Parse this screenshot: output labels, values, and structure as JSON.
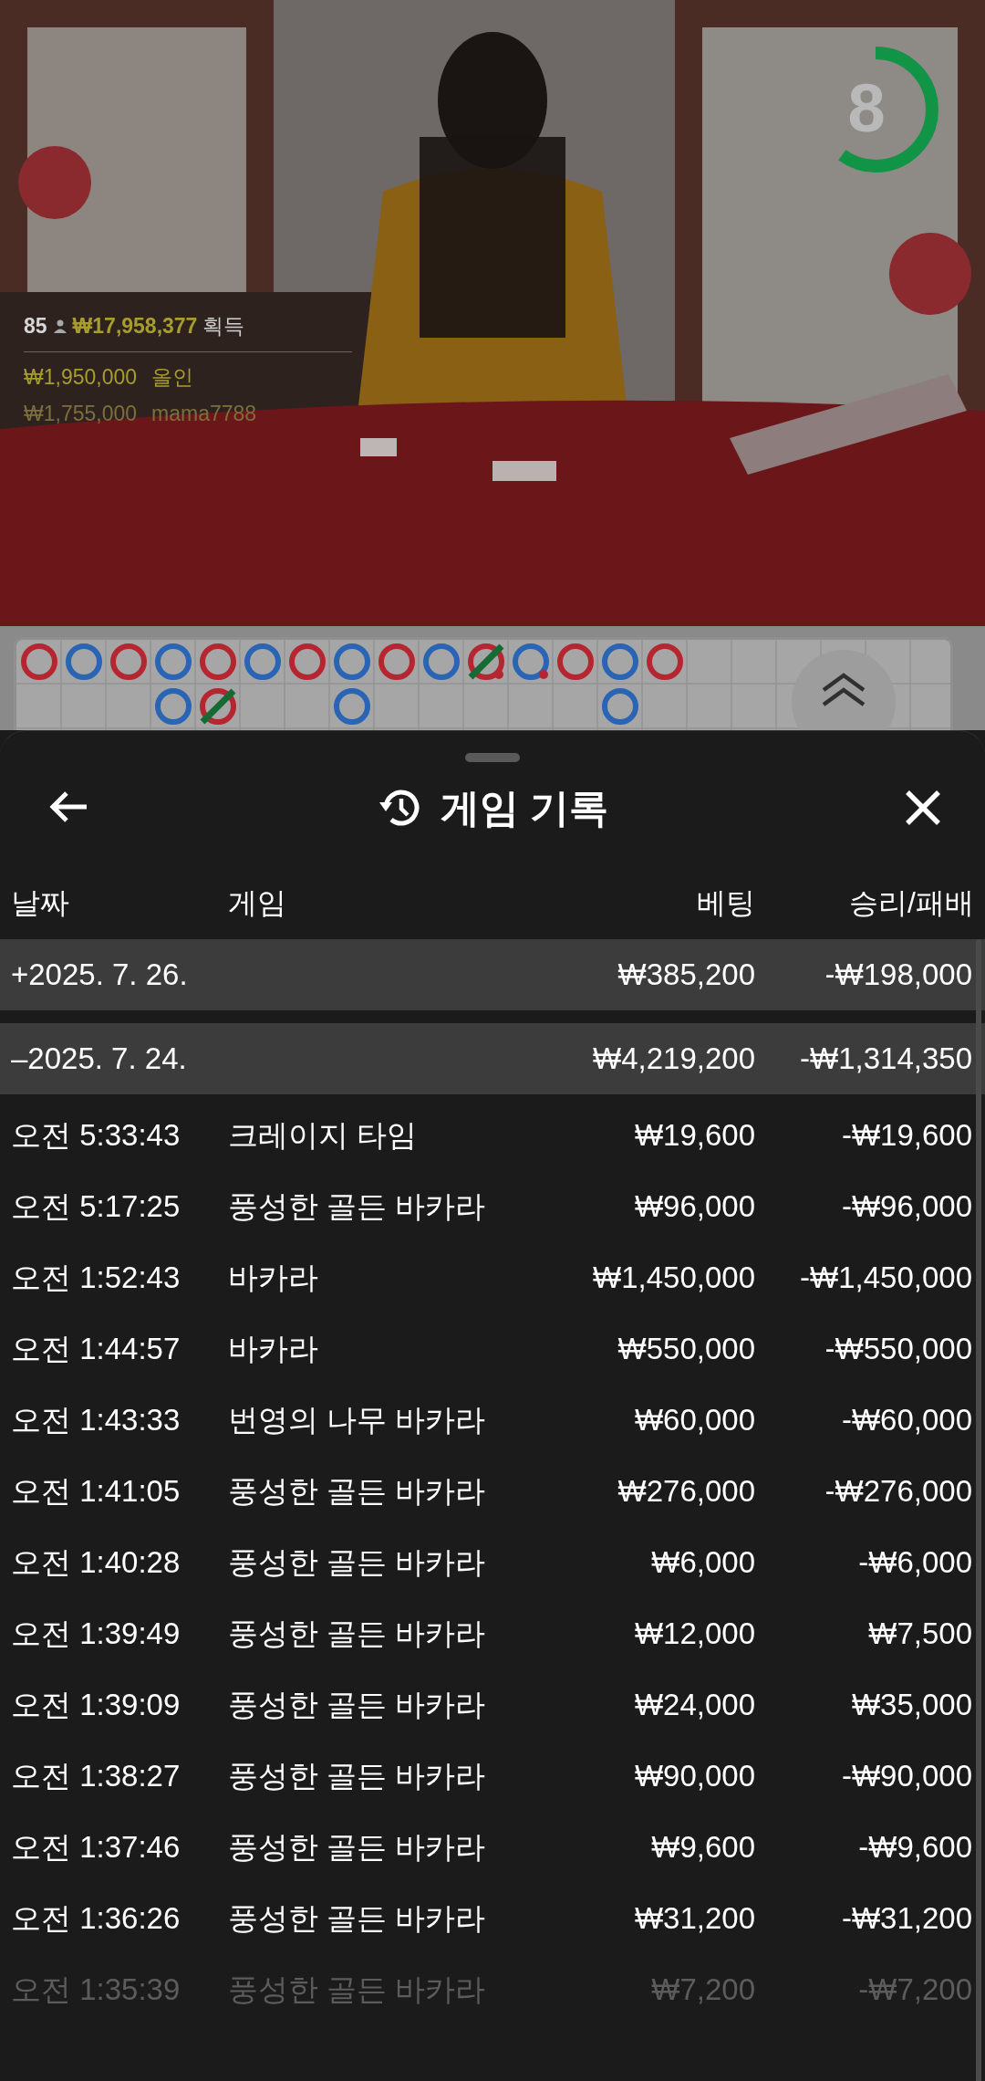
{
  "video": {
    "kind": "picture",
    "timer": {
      "count": "8",
      "level": 0.6
    },
    "stats": {
      "players": "85",
      "total": "₩17,958,377",
      "total_label": "획득"
    },
    "bets": [
      {
        "amount": "₩1,950,000",
        "label": "올인",
        "faded": false
      },
      {
        "amount": "₩1,755,000",
        "label": "mama7788",
        "faded": true
      }
    ]
  },
  "roadmap": {
    "columns": [
      [
        {
          "color": "#b52630",
          "tie": false,
          "pair": false
        }
      ],
      [
        {
          "color": "#2a64b4",
          "tie": false,
          "pair": false
        }
      ],
      [
        {
          "color": "#b52630",
          "tie": false,
          "pair": false
        }
      ],
      [
        {
          "color": "#2a64b4",
          "tie": false,
          "pair": false
        },
        {
          "color": "#2a64b4",
          "tie": false,
          "pair": false
        }
      ],
      [
        {
          "color": "#b52630",
          "tie": false,
          "pair": false
        },
        {
          "color": "#b52630",
          "tie": true,
          "pair": false
        }
      ],
      [
        {
          "color": "#2a64b4",
          "tie": false,
          "pair": false
        }
      ],
      [
        {
          "color": "#b52630",
          "tie": false,
          "pair": false
        }
      ],
      [
        {
          "color": "#2a64b4",
          "tie": false,
          "pair": false
        },
        {
          "color": "#2a64b4",
          "tie": false,
          "pair": false
        }
      ],
      [
        {
          "color": "#b52630",
          "tie": false,
          "pair": false
        }
      ],
      [
        {
          "color": "#2a64b4",
          "tie": false,
          "pair": false
        }
      ],
      [
        {
          "color": "#b52630",
          "tie": true,
          "pair": true
        }
      ],
      [
        {
          "color": "#2a64b4",
          "tie": false,
          "pair": true
        }
      ],
      [
        {
          "color": "#b52630",
          "tie": false,
          "pair": false
        }
      ],
      [
        {
          "color": "#2a64b4",
          "tie": false,
          "pair": false
        },
        {
          "color": "#2a64b4",
          "tie": false,
          "pair": false
        }
      ],
      [
        {
          "color": "#b52630",
          "tie": false,
          "pair": false
        }
      ]
    ]
  },
  "sheet": {
    "title": "게임 기록",
    "columns": [
      "날짜",
      "게임",
      "베팅",
      "승리/패배"
    ],
    "groups": [
      {
        "date": "+2025. 7. 26.",
        "bet": "₩385,200",
        "result": "-₩198,000"
      },
      {
        "date": "–2025. 7. 24.",
        "bet": "₩4,219,200",
        "result": "-₩1,314,350",
        "rows": [
          {
            "time": "오전 5:33:43",
            "game": "크레이지 타임",
            "bet": "₩19,600",
            "result": "-₩19,600",
            "faded": false
          },
          {
            "time": "오전 5:17:25",
            "game": "풍성한 골든 바카라",
            "bet": "₩96,000",
            "result": "-₩96,000",
            "faded": false
          },
          {
            "time": "오전 1:52:43",
            "game": "바카라",
            "bet": "₩1,450,000",
            "result": "-₩1,450,000",
            "faded": false
          },
          {
            "time": "오전 1:44:57",
            "game": "바카라",
            "bet": "₩550,000",
            "result": "-₩550,000",
            "faded": false
          },
          {
            "time": "오전 1:43:33",
            "game": "번영의 나무 바카라",
            "bet": "₩60,000",
            "result": "-₩60,000",
            "faded": false
          },
          {
            "time": "오전 1:41:05",
            "game": "풍성한 골든 바카라",
            "bet": "₩276,000",
            "result": "-₩276,000",
            "faded": false
          },
          {
            "time": "오전 1:40:28",
            "game": "풍성한 골든 바카라",
            "bet": "₩6,000",
            "result": "-₩6,000",
            "faded": false
          },
          {
            "time": "오전 1:39:49",
            "game": "풍성한 골든 바카라",
            "bet": "₩12,000",
            "result": "₩7,500",
            "faded": false
          },
          {
            "time": "오전 1:39:09",
            "game": "풍성한 골든 바카라",
            "bet": "₩24,000",
            "result": "₩35,000",
            "faded": false
          },
          {
            "time": "오전 1:38:27",
            "game": "풍성한 골든 바카라",
            "bet": "₩90,000",
            "result": "-₩90,000",
            "faded": false
          },
          {
            "time": "오전 1:37:46",
            "game": "풍성한 골든 바카라",
            "bet": "₩9,600",
            "result": "-₩9,600",
            "faded": false
          },
          {
            "time": "오전 1:36:26",
            "game": "풍성한 골든 바카라",
            "bet": "₩31,200",
            "result": "-₩31,200",
            "faded": false
          },
          {
            "time": "오전 1:35:39",
            "game": "풍성한 골든 바카라",
            "bet": "₩7,200",
            "result": "-₩7,200",
            "faded": true
          }
        ]
      }
    ]
  }
}
